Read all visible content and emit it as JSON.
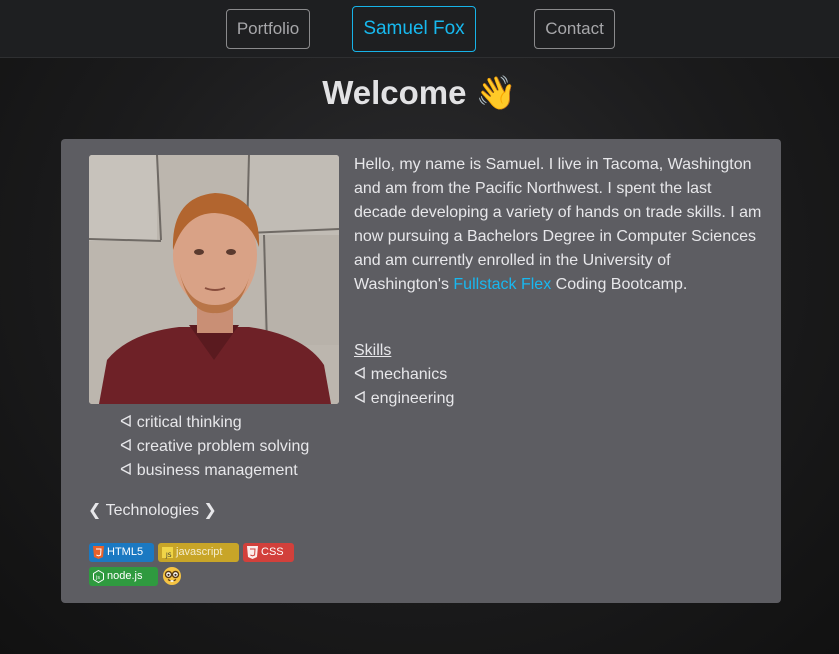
{
  "nav": {
    "portfolio": "Portfolio",
    "name": "Samuel Fox",
    "contact": "Contact"
  },
  "welcome": "Welcome 👋",
  "bio": {
    "text_before_link": "Hello, my name is Samuel. I live in Tacoma, Washington and am from the Pacific Northwest. I spent the last decade developing a variety of hands on trade skills. I am now pursuing a Bachelors Degree in Computer Sciences and am currently enrolled in the University of Washington's ",
    "link": "Fullstack Flex",
    "text_after_link": " Coding Bootcamp."
  },
  "skills": {
    "heading": "Skills",
    "items": [
      "ᐊ mechanics",
      "ᐊ engineering",
      "ᐊ critical thinking",
      "ᐊ creative problem solving",
      "ᐊ business management"
    ]
  },
  "technologies": {
    "heading": "❮ Technologies ❯",
    "badges": [
      "HTML5",
      "javascript",
      "CSS",
      "node.js"
    ],
    "emoji": "🤓"
  },
  "colors": {
    "accent": "#17b9ef",
    "card": "#5d5d62",
    "html5": "#1b79c2",
    "javascript": "#c8a528",
    "css": "#d2403b",
    "nodejs": "#2f9a3f"
  },
  "icons": [
    "html5-icon",
    "javascript-icon",
    "css3-icon",
    "nodejs-icon",
    "nerd-face-icon",
    "waving-hand-icon"
  ]
}
